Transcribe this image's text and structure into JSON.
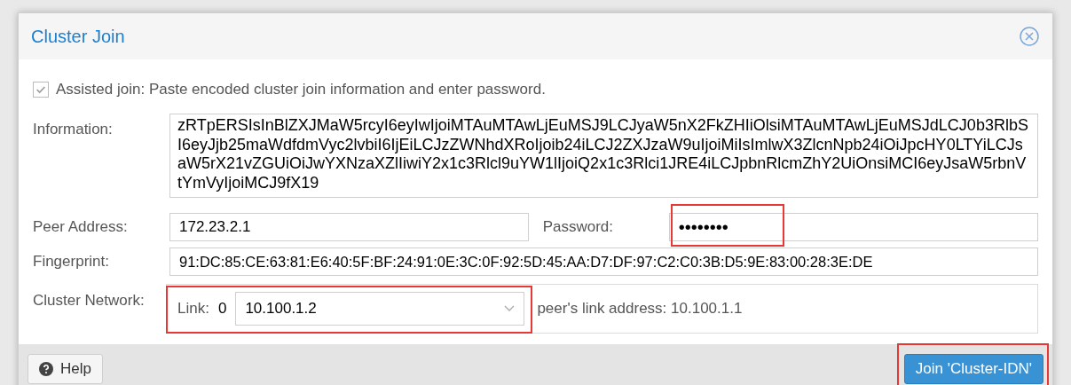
{
  "dialog": {
    "title": "Cluster Join"
  },
  "assisted_join": {
    "label": "Assisted join: Paste encoded cluster join information and enter password.",
    "checked": true
  },
  "information": {
    "label": "Information:",
    "value": "zRTpERSIsInBlZXJMaW5rcyI6eyIwIjoiMTAuMTAwLjEuMSJ9LCJyaW5nX2FkZHIiOlsiMTAuMTAwLjEuMSJdLCJ0b3RlbSI6eyJjb25maWdfdmVyc2lvbiI6IjEiLCJzZWNhdXRoIjoib24iLCJ2ZXJzaW9uIjoiMiIsImlwX3ZlcnNpb24iOiJpcHY0LTYiLCJsaW5rX21vZGUiOiJwYXNzaXZlIiwiY2x1c3Rlcl9uYW1lIjoiQ2x1c3Rlci1JRE4iLCJpbnRlcmZhY2UiOnsiMCI6eyJsaW5rbnVtYmVyIjoiMCJ9fX19",
    "highlighted": false
  },
  "peer_address": {
    "label": "Peer Address:",
    "value": "172.23.2.1",
    "highlighted": false
  },
  "password": {
    "label": "Password:",
    "value": "••••••••",
    "highlighted": true
  },
  "fingerprint": {
    "label": "Fingerprint:",
    "value": "91:DC:85:CE:63:81:E6:40:5F:BF:24:91:0E:3C:0F:92:5D:45:AA:D7:DF:97:C2:C0:3B:D5:9E:83:00:28:3E:DE",
    "highlighted": false
  },
  "cluster_network": {
    "label": "Cluster Network:",
    "link_label": "Link:",
    "link_number": "0",
    "link_value": "10.100.1.2",
    "peer_link": "peer's link address: 10.100.1.1",
    "highlighted": true
  },
  "footer": {
    "help": "Help",
    "join": "Join 'Cluster-IDN'",
    "join_highlighted": true
  }
}
